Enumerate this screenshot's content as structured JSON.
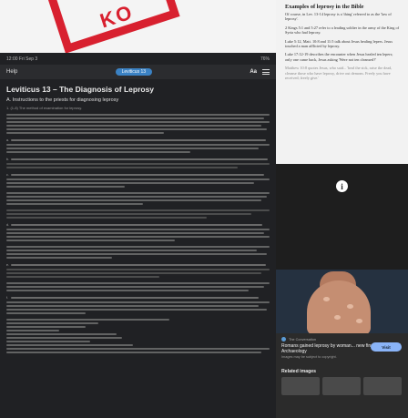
{
  "stamp_text": "KO",
  "status_bar": {
    "time": "12:00 Fri Sep 3",
    "battery": "76%"
  },
  "app_bar": {
    "help": "Help",
    "chapter": "Leviticus 13",
    "font": "Aa"
  },
  "reader": {
    "chapter_title": "Leviticus 13 – The Diagnosis of Leprosy",
    "subheading": "A. Instructions to the priests for diagnosing leprosy",
    "note": "1. (1-8) The method of examination for leprosy."
  },
  "side_panel": {
    "heading": "Examples of leprosy in the Bible",
    "paragraphs": [
      "Of course, in Lev. 13-14 leprosy is a 'thing' referred to as the 'law of leprosy'.",
      "2 Kings 5:1 and 5:27 refer to a leading soldier in the army of the King of Syria who had leprosy.",
      "Luke 5:12, Matt. 10:8 and 11:5 talk about Jesus healing lepers. Jesus touched a man afflicted by leprosy.",
      "Luke 17:12-19 describes the encounter when Jesus healed ten lepers; only one came back, Jesus asking 'Were not ten cleansed?'"
    ],
    "faded_paragraph": "Matthew 10:8 quotes Jesus, who said... 'heal the sick, raise the dead, cleanse those who have leprosy, drive out demons. Freely you have received; freely give.'",
    "info_icon": "i",
    "result": {
      "source": "The Conversation",
      "title": "Romans gained leprosy by woman... new finds uncovered | Archaeology",
      "subtitle": "Images may be subject to copyright.",
      "visit": "Visit",
      "related": "Related images"
    }
  }
}
